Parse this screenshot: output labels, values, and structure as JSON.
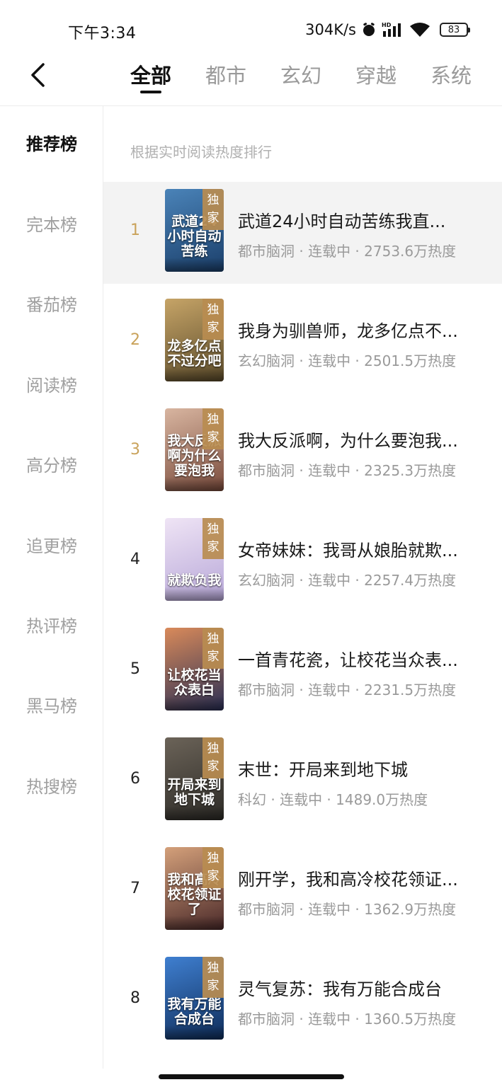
{
  "status_bar": {
    "time": "下午3:34",
    "net_speed": "304K/s",
    "battery": "83",
    "hd_label": "HD"
  },
  "nav": {
    "tabs": [
      {
        "label": "全部"
      },
      {
        "label": "都市"
      },
      {
        "label": "玄幻"
      },
      {
        "label": "穿越"
      },
      {
        "label": "系统"
      }
    ],
    "active_tab": "全部"
  },
  "sidebar": {
    "items": [
      {
        "label": "推荐榜"
      },
      {
        "label": "完本榜"
      },
      {
        "label": "番茄榜"
      },
      {
        "label": "阅读榜"
      },
      {
        "label": "高分榜"
      },
      {
        "label": "追更榜"
      },
      {
        "label": "热评榜"
      },
      {
        "label": "黑马榜"
      },
      {
        "label": "热搜榜"
      }
    ],
    "active_item": "推荐榜"
  },
  "content": {
    "subtitle": "根据实时阅读热度排行",
    "exclusive_badge": "独家",
    "books": [
      {
        "rank": "1",
        "title": "武道24小时自动苦练我直...",
        "meta": "都市脑洞 · 连载中 · 2753.6万热度",
        "cover_text": "武道24小时自动苦练",
        "cover_colors": [
          "#1b3f6b",
          "#4a83b8"
        ]
      },
      {
        "rank": "2",
        "title": "我身为驯兽师，龙多亿点不...",
        "meta": "玄幻脑洞 · 连载中 · 2501.5万热度",
        "cover_text": "龙多亿点不过分吧",
        "cover_colors": [
          "#5a4a2a",
          "#c6a467"
        ]
      },
      {
        "rank": "3",
        "title": "我大反派啊，为什么要泡我...",
        "meta": "都市脑洞 · 连载中 · 2325.3万热度",
        "cover_text": "我大反派啊为什么要泡我",
        "cover_colors": [
          "#7a4b3c",
          "#d8b5a0"
        ]
      },
      {
        "rank": "4",
        "title": "女帝妹妹：我哥从娘胎就欺...",
        "meta": "玄幻脑洞 · 连载中 · 2257.4万热度",
        "cover_text": "就欺负我",
        "cover_colors": [
          "#b7a7d8",
          "#efe4f5"
        ]
      },
      {
        "rank": "5",
        "title": "一首青花瓷，让校花当众表...",
        "meta": "都市脑洞 · 连载中 · 2231.5万热度",
        "cover_text": "让校花当众表白",
        "cover_colors": [
          "#2a2f55",
          "#d98a5a"
        ]
      },
      {
        "rank": "6",
        "title": "末世：开局来到地下城",
        "meta": "科幻 · 连载中 · 1489.0万热度",
        "cover_text": "开局来到地下城",
        "cover_colors": [
          "#2c2a26",
          "#6b6358"
        ]
      },
      {
        "rank": "7",
        "title": "刚开学，我和高冷校花领证...",
        "meta": "都市脑洞 · 连载中 · 1362.9万热度",
        "cover_text": "我和高冷校花领证了",
        "cover_colors": [
          "#4b2a2a",
          "#d4a07a"
        ]
      },
      {
        "rank": "8",
        "title": "灵气复苏：我有万能合成台",
        "meta": "都市脑洞 · 连载中 · 1360.5万热度",
        "cover_text": "我有万能合成台",
        "cover_colors": [
          "#0f2d5a",
          "#3f7fd0"
        ]
      }
    ]
  },
  "colors": {
    "rank_gold": "#c9a25a",
    "badge": "#b88c50",
    "highlight_row": "#f3f3f3"
  }
}
